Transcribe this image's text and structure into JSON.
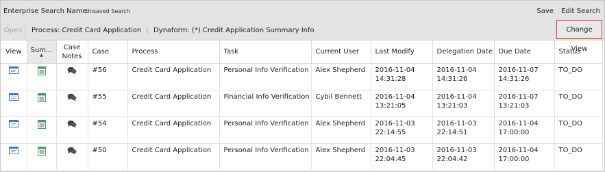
{
  "topbar": {
    "search_label": "Enterprise Search Name:",
    "search_value": "Unsaved Search",
    "save_label": "Save",
    "edit_label": "Edit Search"
  },
  "toolbar": {
    "open_label": "Open",
    "process_label": "Process:",
    "process_value": "Credit Card Application",
    "dynaform_label": "Dynaform:",
    "dynaform_value": "(*) Credit Application Summary Info",
    "change_view_label": "Change View"
  },
  "table": {
    "headers": {
      "view": "View",
      "summary": "Sum...",
      "case_notes_1": "Case",
      "case_notes_2": "Notes",
      "case": "Case",
      "process": "Process",
      "task": "Task",
      "current_user": "Current User",
      "last_modify": "Last Modify",
      "delegation_date": "Delegation Date",
      "due_date": "Due Date",
      "status": "Status"
    },
    "rows": [
      {
        "case": "#56",
        "process": "Credit Card Application",
        "task": "Personal Info Verification",
        "user": "Alex Shepherd",
        "last_modify_date": "2016-11-04",
        "last_modify_time": "14:31:28",
        "delegation_date": "2016-11-04",
        "delegation_time": "14:31:26",
        "due_date": "2016-11-07",
        "due_time": "14:31:26",
        "status": "TO_DO"
      },
      {
        "case": "#55",
        "process": "Credit Card Application",
        "task": "Financial Info Verification",
        "user": "Cybil Bennett",
        "last_modify_date": "2016-11-04",
        "last_modify_time": "13:21:05",
        "delegation_date": "2016-11-04",
        "delegation_time": "13:21:03",
        "due_date": "2016-11-07",
        "due_time": "13:21:03",
        "status": "TO_DO"
      },
      {
        "case": "#54",
        "process": "Credit Card Application",
        "task": "Personal Info Verification",
        "user": "Alex Shepherd",
        "last_modify_date": "2016-11-03",
        "last_modify_time": "22:14:55",
        "delegation_date": "2016-11-03",
        "delegation_time": "22:14:51",
        "due_date": "2016-11-04",
        "due_time": "17:00:00",
        "status": "TO_DO"
      },
      {
        "case": "#50",
        "process": "Credit Card Application",
        "task": "Personal Info Verification",
        "user": "Alex Shepherd",
        "last_modify_date": "2016-11-03",
        "last_modify_time": "22:04:45",
        "delegation_date": "2016-11-03",
        "delegation_time": "22:04:42",
        "due_date": "2016-11-04",
        "due_time": "17:00:00",
        "status": "TO_DO"
      }
    ]
  },
  "icons": {
    "view": "view-window-icon",
    "summary": "summary-sheet-icon",
    "notes": "speech-bubbles-icon",
    "view_color": "#3d78c8",
    "summary_color": "#4a9a5a"
  }
}
